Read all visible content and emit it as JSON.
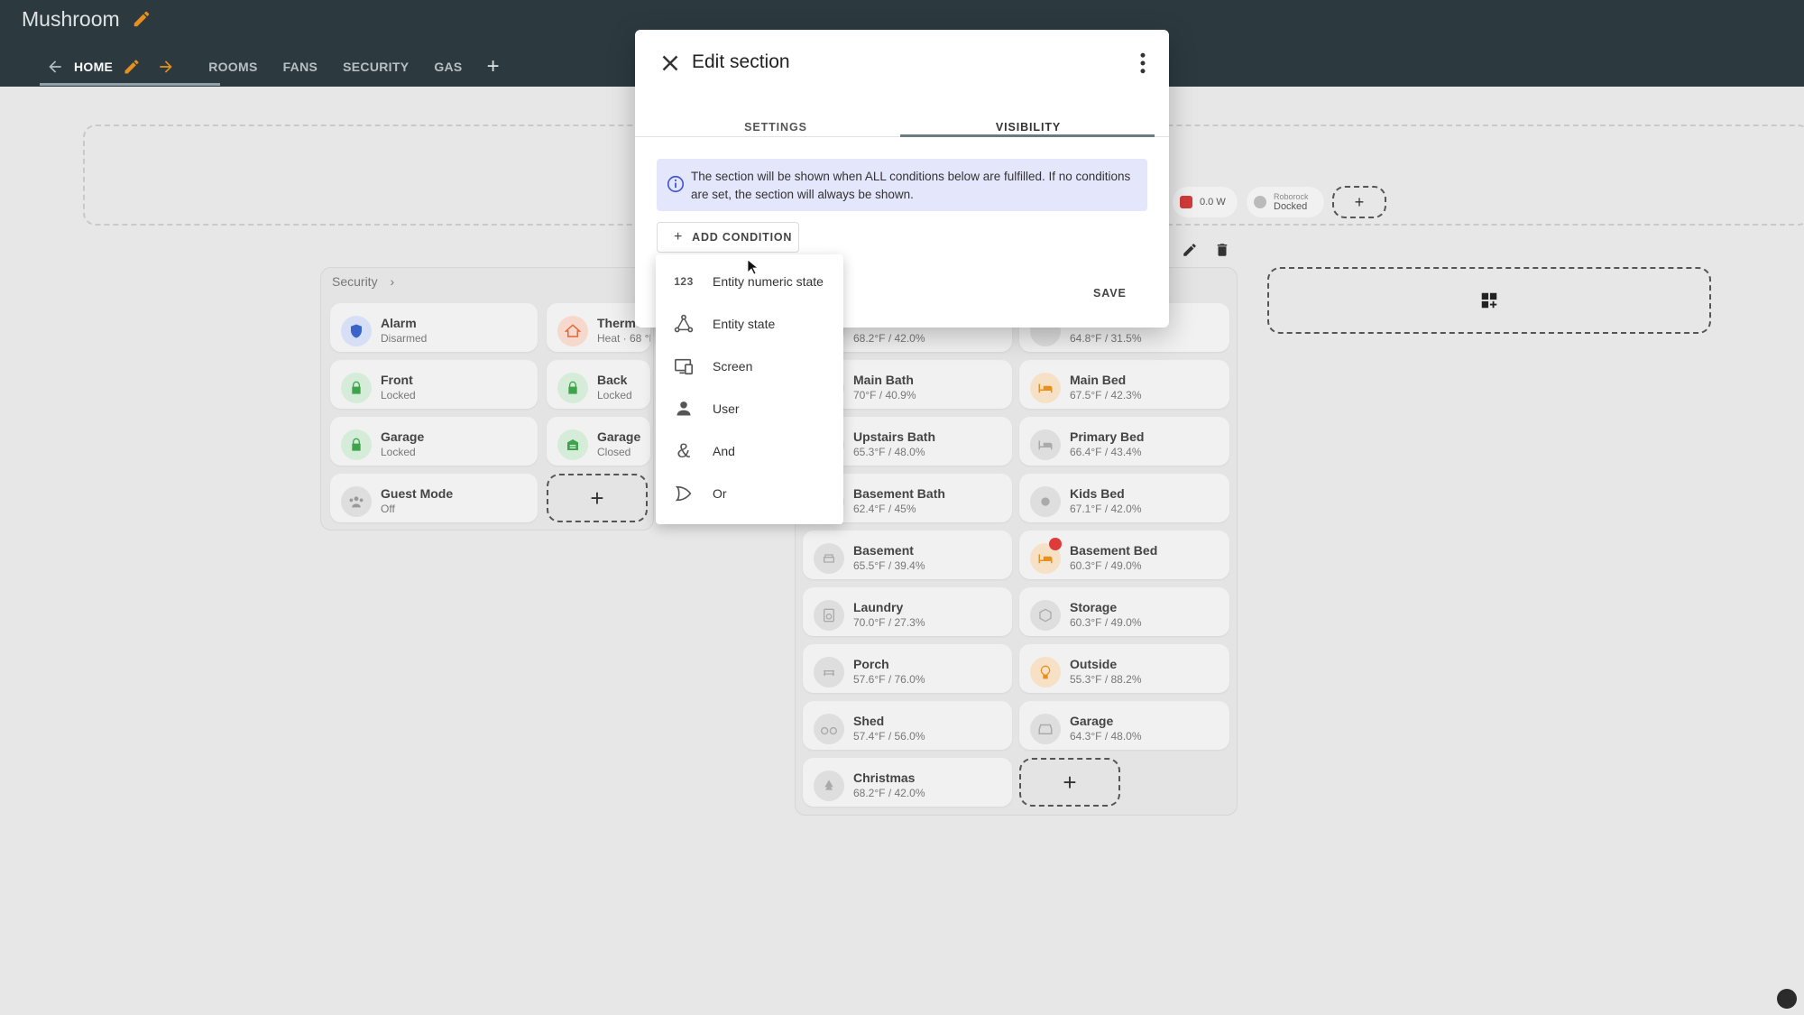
{
  "app": {
    "title": "Mushroom"
  },
  "nav": {
    "tabs": [
      {
        "label": "HOME"
      },
      {
        "label": "ROOMS"
      },
      {
        "label": "FANS"
      },
      {
        "label": "SECURITY"
      },
      {
        "label": "GAS"
      }
    ]
  },
  "background": {
    "chips": [
      {
        "value": "0.0 W"
      },
      {
        "line1": "Roborock",
        "line2": "Docked"
      }
    ],
    "security_section": {
      "title": "Security",
      "cards": [
        {
          "name": "Alarm",
          "value": "Disarmed"
        },
        {
          "name": "Thermo",
          "value": "Heat · 68 °F"
        },
        {
          "name": "Front",
          "value": "Locked"
        },
        {
          "name": "Back",
          "value": "Locked"
        },
        {
          "name": "Garage",
          "value": "Locked"
        },
        {
          "name": "Garage",
          "value": "Closed"
        },
        {
          "name": "Guest Mode",
          "value": "Off"
        }
      ]
    },
    "rooms_section": {
      "cards": [
        {
          "name": "",
          "value": "68.2°F / 42.0%"
        },
        {
          "name": "",
          "value": "64.8°F / 31.5%"
        },
        {
          "name": "Main Bath",
          "value": "70°F / 40.9%"
        },
        {
          "name": "Main Bed",
          "value": "67.5°F / 42.3%"
        },
        {
          "name": "Upstairs Bath",
          "value": "65.3°F / 48.0%"
        },
        {
          "name": "Primary Bed",
          "value": "66.4°F / 43.4%"
        },
        {
          "name": "Basement Bath",
          "value": "62.4°F / 45%"
        },
        {
          "name": "Kids Bed",
          "value": "67.1°F / 42.0%"
        },
        {
          "name": "Basement",
          "value": "65.5°F / 39.4%"
        },
        {
          "name": "Basement Bed",
          "value": "60.3°F / 49.0%"
        },
        {
          "name": "Laundry",
          "value": "70.0°F / 27.3%"
        },
        {
          "name": "Storage",
          "value": "60.3°F / 49.0%"
        },
        {
          "name": "Porch",
          "value": "57.6°F / 76.0%"
        },
        {
          "name": "Outside",
          "value": "55.3°F / 88.2%"
        },
        {
          "name": "Shed",
          "value": "57.4°F / 56.0%"
        },
        {
          "name": "Garage",
          "value": "64.3°F / 48.0%"
        },
        {
          "name": "Christmas",
          "value": "68.2°F / 42.0%"
        }
      ]
    }
  },
  "dialog": {
    "title": "Edit section",
    "tabs": [
      {
        "label": "SETTINGS"
      },
      {
        "label": "VISIBILITY"
      }
    ],
    "info_text": "The section will be shown when ALL conditions below are fulfilled. If no conditions are set, the section will always be shown.",
    "add_condition_label": "ADD CONDITION",
    "save_label": "SAVE"
  },
  "condition_menu": {
    "items": [
      {
        "label": "Entity numeric state",
        "icon": "numeric-icon",
        "glyph": "123"
      },
      {
        "label": "Entity state",
        "icon": "state-graph-icon"
      },
      {
        "label": "Screen",
        "icon": "screen-icon"
      },
      {
        "label": "User",
        "icon": "user-icon"
      },
      {
        "label": "And",
        "icon": "ampersand-icon",
        "glyph": "&"
      },
      {
        "label": "Or",
        "icon": "gate-or-icon"
      }
    ]
  },
  "colors": {
    "topbar": "#2c3a40",
    "accent_orange": "#e8901c",
    "lock_green": "#3fa34d",
    "info_bg": "#e4e6fb",
    "alarm_blue": "#3b64c8"
  }
}
